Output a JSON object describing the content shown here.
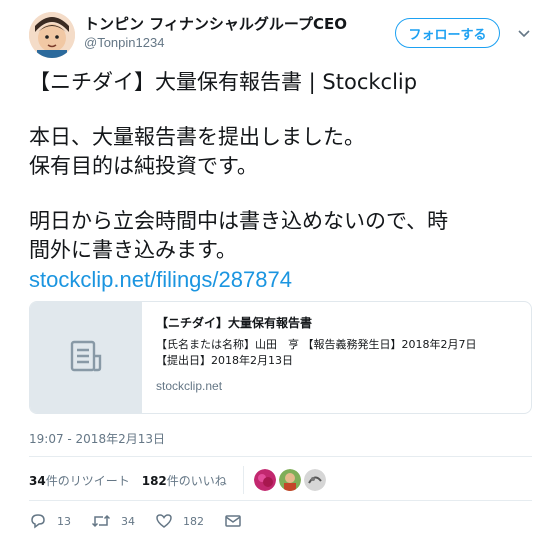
{
  "user": {
    "display_name": "トンピン フィナンシャルグループCEO",
    "handle": "@Tonpin1234"
  },
  "follow_button": "フォローする",
  "tweet": {
    "lines": [
      "【ニチダイ】大量保有報告書 | Stockclip",
      "本日、大量報告書を提出しました。",
      "保有目的は純投資です。",
      "明日から立会時間中は書き込めないので、時",
      "間外に書き込みます。"
    ],
    "link": "stockclip.net/filings/287874"
  },
  "card": {
    "title": "【ニチダイ】大量保有報告書",
    "desc_line1": "【氏名または名称】山田　亨 【報告義務発生日】2018年2月7日",
    "desc_line2": "【提出日】2018年2月13日",
    "domain": "stockclip.net"
  },
  "timestamp": "19:07 - 2018年2月13日",
  "stats": {
    "retweets_count": "34",
    "retweets_label": "件のリツイート",
    "likes_count": "182",
    "likes_label": "件のいいね"
  },
  "actions": {
    "reply_count": "13",
    "retweet_count": "34",
    "like_count": "182"
  },
  "colors": {
    "accent": "#1da1f2",
    "link": "#1b95e0",
    "muted": "#657786"
  }
}
